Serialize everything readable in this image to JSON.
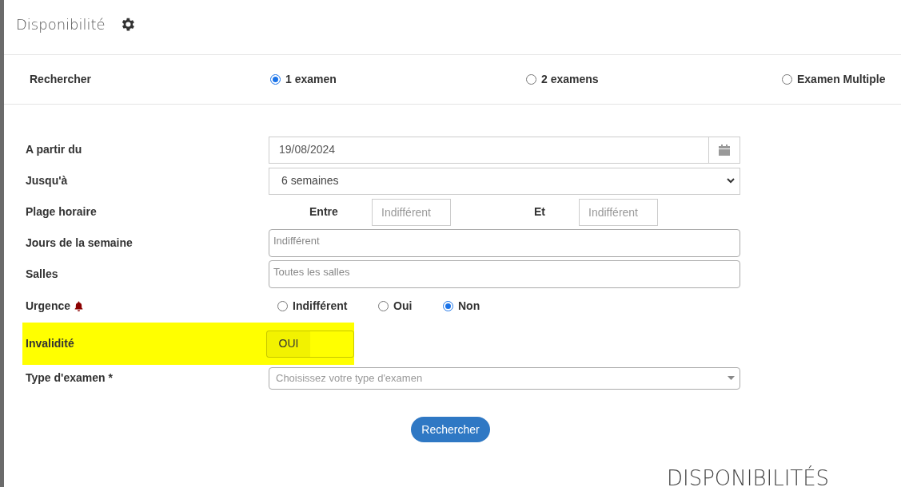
{
  "header": {
    "title": "Disponibilité"
  },
  "search_mode": {
    "label": "Rechercher",
    "options": [
      {
        "label": "1 examen",
        "selected": true
      },
      {
        "label": "2 examens",
        "selected": false
      },
      {
        "label": "Examen Multiple",
        "selected": false
      }
    ]
  },
  "form": {
    "rows": [
      {
        "kind": "date",
        "label": "A partir du",
        "value": "19/08/2024"
      },
      {
        "kind": "select",
        "label": "Jusqu'à",
        "value": "6 semaines"
      },
      {
        "kind": "range",
        "label": "Plage horaire",
        "from_label": "Entre",
        "from_placeholder": "Indifférent",
        "to_label": "Et",
        "to_placeholder": "Indifférent"
      },
      {
        "kind": "text",
        "label": "Jours de la semaine",
        "placeholder": "Indifférent"
      },
      {
        "kind": "text",
        "label": "Salles",
        "placeholder": "Toutes les salles"
      },
      {
        "kind": "radio",
        "label": "Urgence",
        "options": [
          {
            "label": "Indifférent",
            "selected": false
          },
          {
            "label": "Oui",
            "selected": false
          },
          {
            "label": "Non",
            "selected": true
          }
        ]
      },
      {
        "kind": "toggle",
        "label": "Invalidité",
        "value": "OUI",
        "on": true,
        "highlighted": true
      },
      {
        "kind": "combo",
        "label": "Type d'examen *",
        "placeholder": "Choisissez votre type d'examen"
      }
    ]
  },
  "submit_button": "Rechercher",
  "results_title": "DISPONIBILITÉS"
}
